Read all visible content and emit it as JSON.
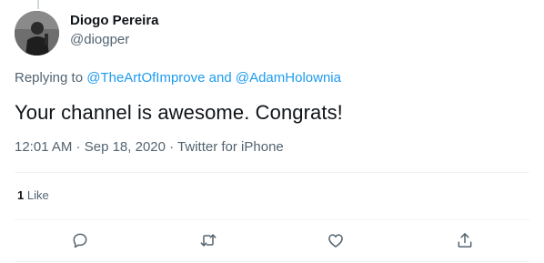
{
  "author": {
    "display_name": "Diogo Pereira",
    "handle": "@diogper"
  },
  "reply": {
    "prefix": "Replying to ",
    "mention_1": "@TheArtOfImprove",
    "conjunction": " and ",
    "mention_2": "@AdamHolownia"
  },
  "tweet": {
    "text": "Your channel is awesome. Congrats!",
    "time": "12:01 AM",
    "separator": " · ",
    "date": "Sep 18, 2020",
    "source": "Twitter for iPhone"
  },
  "stats": {
    "like_count": "1",
    "like_label": " Like"
  },
  "actions": {
    "icons": [
      "reply-icon",
      "retweet-icon",
      "like-icon",
      "share-icon"
    ]
  },
  "colors": {
    "text": "#0f1419",
    "secondary": "#536471",
    "accent": "#1d9bf0",
    "divider": "#eff3f4"
  }
}
